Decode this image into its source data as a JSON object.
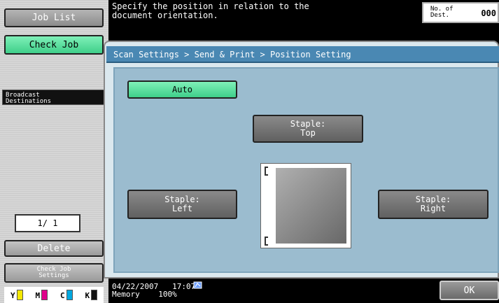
{
  "left_panel": {
    "job_list": "Job List",
    "check_job": "Check Job",
    "broadcast": "Broadcast\nDestinations",
    "page_indicator": "1/ 1",
    "delete": "Delete",
    "check_job_settings": "Check Job\nSettings",
    "toner": [
      {
        "label": "Y",
        "color": "#f4e800"
      },
      {
        "label": "M",
        "color": "#e0008a"
      },
      {
        "label": "C",
        "color": "#00a8e0"
      },
      {
        "label": "K",
        "color": "#111111"
      }
    ]
  },
  "header": {
    "message": "Specify the position in relation to the\ndocument orientation.",
    "dest_label": "No. of\nDest.",
    "dest_count": "000"
  },
  "breadcrumb": "Scan Settings > Send & Print > Position Setting",
  "options": {
    "auto": "Auto",
    "top": "Staple:\nTop",
    "left": "Staple:\nLeft",
    "right": "Staple:\nRight"
  },
  "status": {
    "datetime": "04/22/2007   17:07",
    "memory_label": "Memory",
    "memory_value": "100%"
  },
  "ok": "OK",
  "colors": {
    "accent_green": "#3fcf8a",
    "breadcrumb_blue": "#4a88b3",
    "panel_blue": "#9bbccf"
  }
}
